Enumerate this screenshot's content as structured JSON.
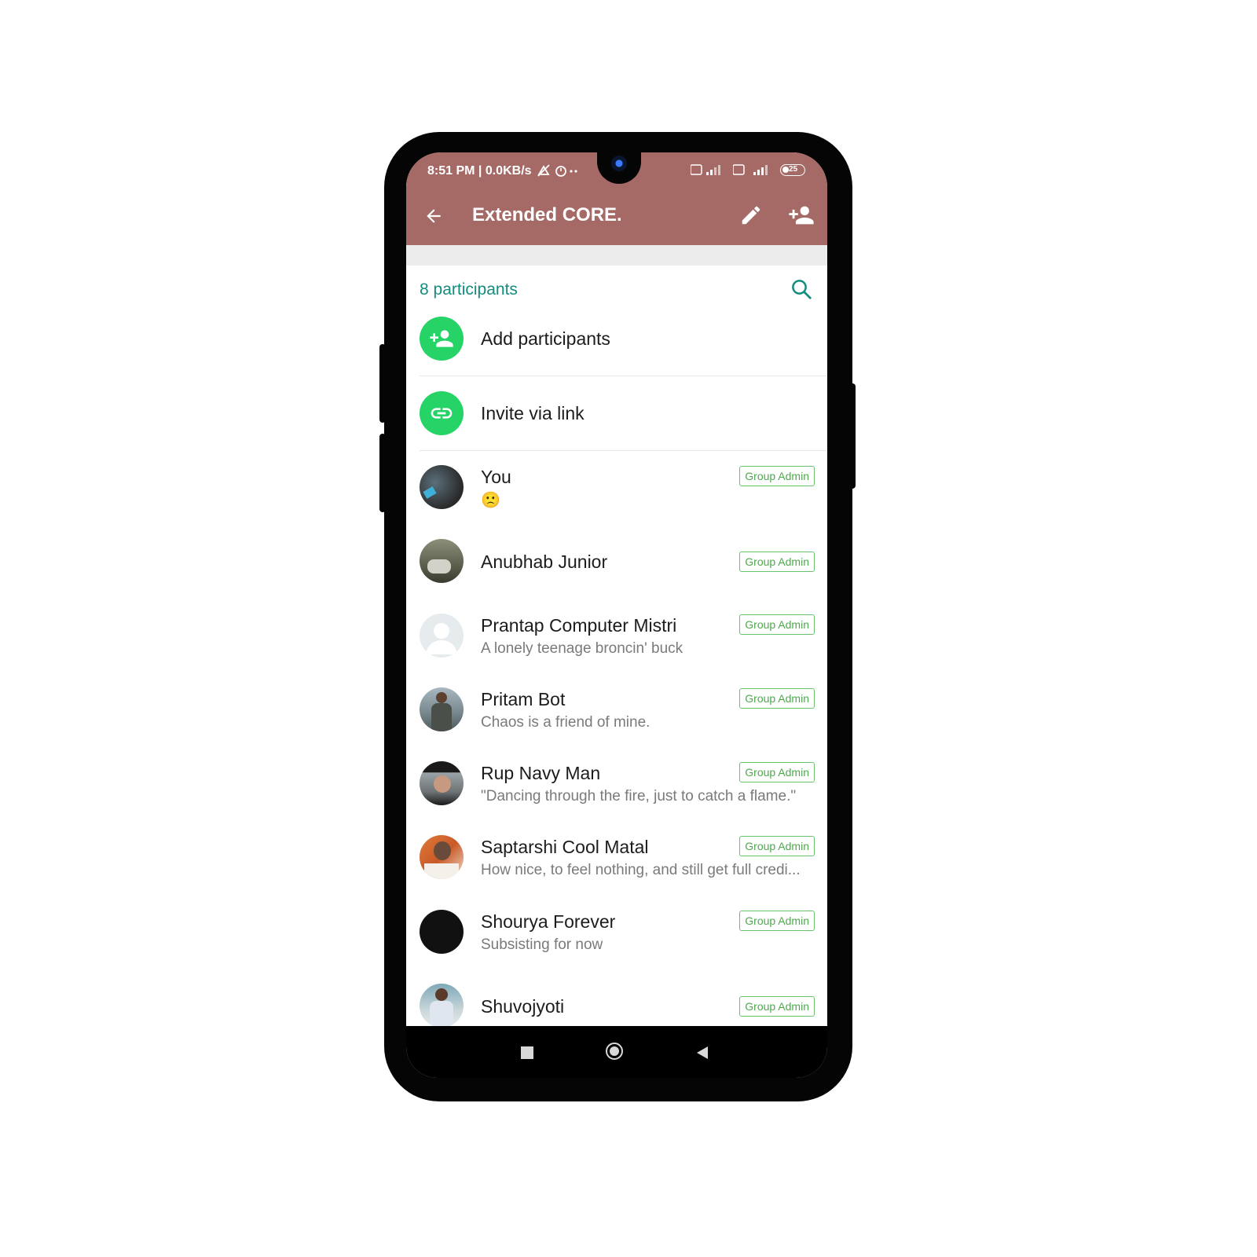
{
  "status_bar": {
    "time_info": "8:51 PM | 0.0KB/s",
    "battery": "25"
  },
  "app_bar": {
    "title": "Extended CORE."
  },
  "participants_header": {
    "count_label": "8 participants"
  },
  "actions": [
    {
      "label": "Add participants",
      "icon": "add-person-icon"
    },
    {
      "label": "Invite via link",
      "icon": "link-icon"
    }
  ],
  "members": [
    {
      "name": "You",
      "about": "🙁",
      "badge": "Group Admin"
    },
    {
      "name": "Anubhab Junior",
      "about": "",
      "badge": "Group Admin"
    },
    {
      "name": "Prantap Computer Mistri",
      "about": "A lonely teenage broncin' buck",
      "badge": "Group Admin"
    },
    {
      "name": "Pritam Bot",
      "about": "Chaos is a friend of mine.",
      "badge": "Group Admin"
    },
    {
      "name": "Rup Navy Man",
      "about": "\"Dancing through the fire, just to catch a flame.\"",
      "badge": "Group Admin"
    },
    {
      "name": "Saptarshi Cool Matal",
      "about": "How nice, to feel nothing, and still get full credi...",
      "badge": "Group Admin"
    },
    {
      "name": "Shourya Forever",
      "about": "Subsisting for now",
      "badge": "Group Admin"
    },
    {
      "name": "Shuvojyoti",
      "about": "",
      "badge": "Group Admin"
    }
  ],
  "colors": {
    "app_bar": "#a66a66",
    "accent_teal": "#128c7e",
    "action_green": "#25d366",
    "badge_green": "#4caa4c"
  }
}
